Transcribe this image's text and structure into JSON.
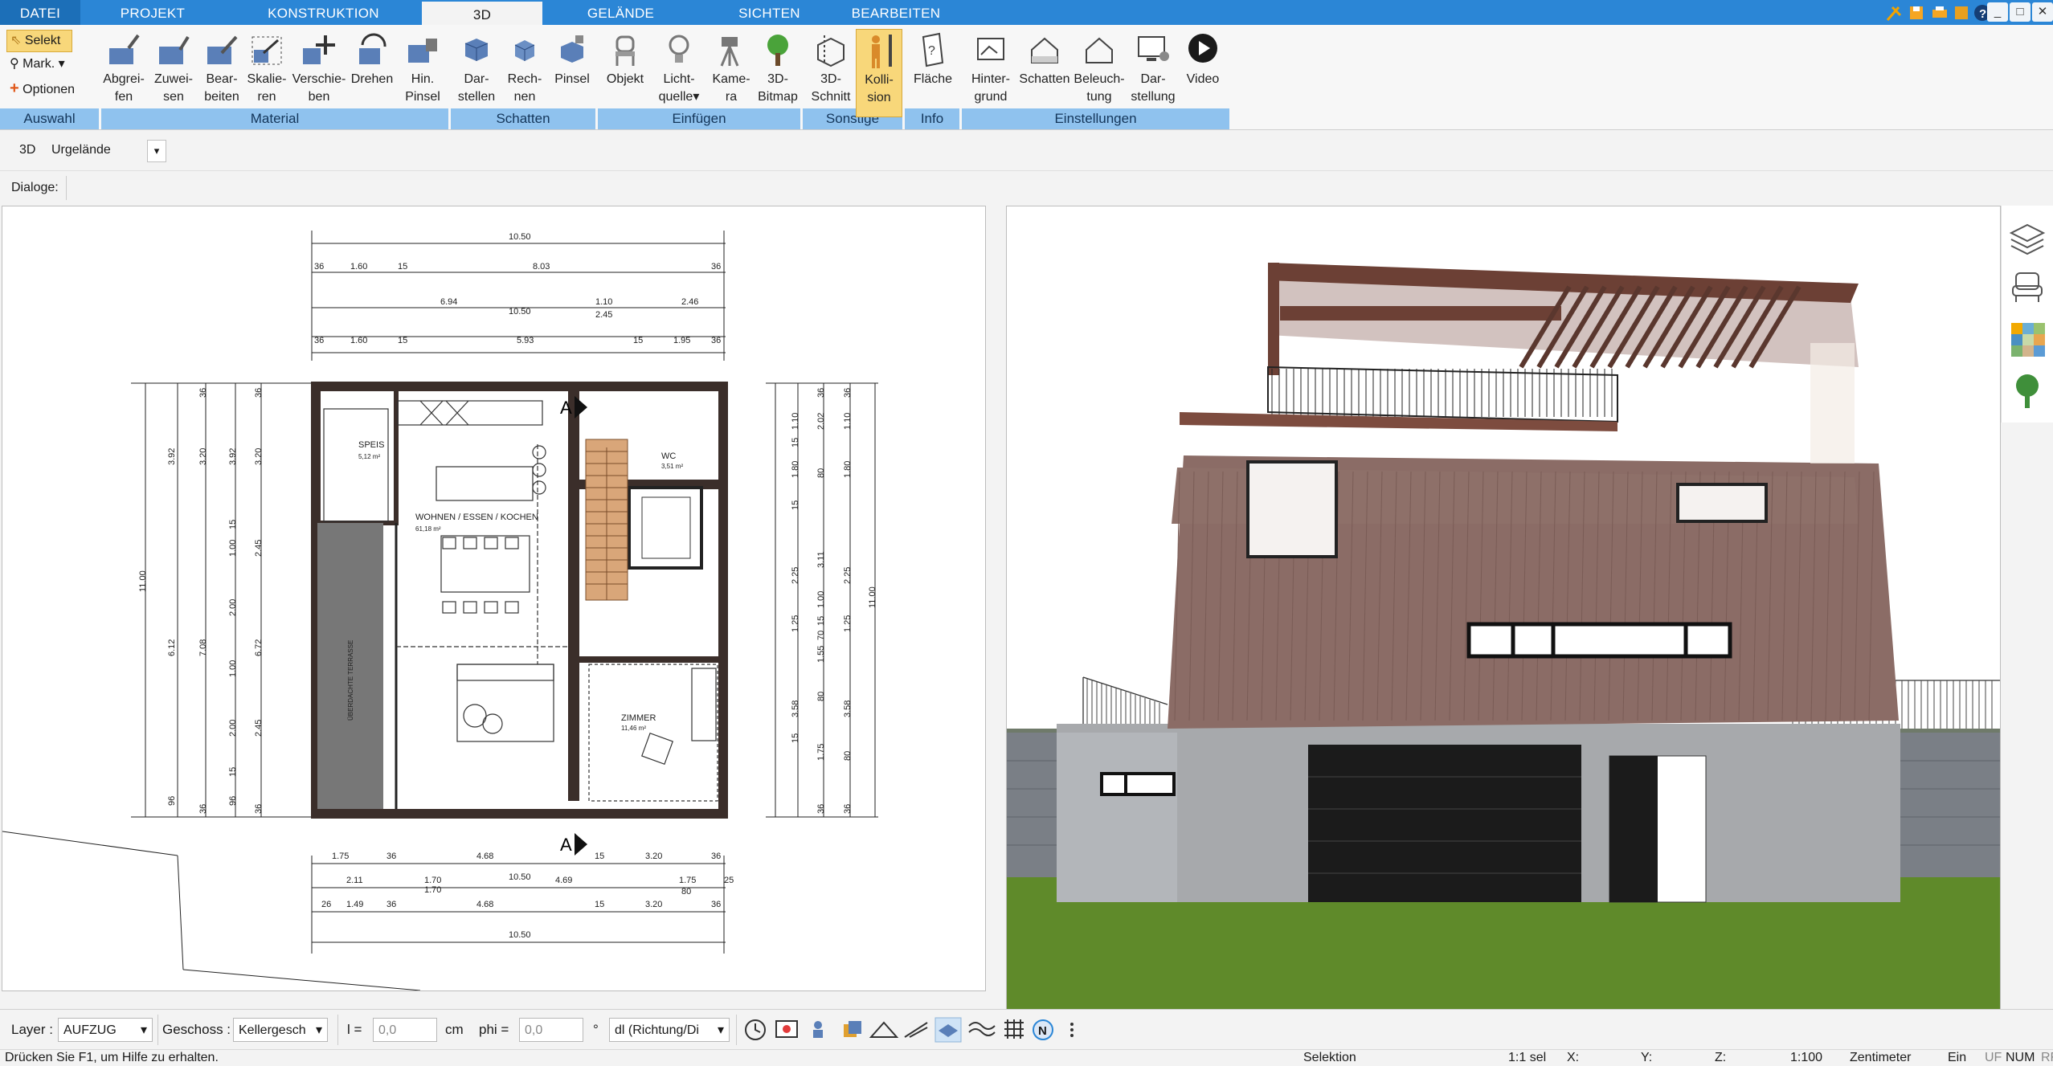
{
  "tabs": [
    "DATEI",
    "PROJEKT",
    "KONSTRUKTION",
    "3D",
    "GELÄNDE",
    "SICHTEN",
    "BEARBEITEN"
  ],
  "window_buttons": [
    "_",
    "□",
    "✕"
  ],
  "auswahl": {
    "selekt": "Selekt",
    "mark": "Mark.",
    "optionen": "Optionen",
    "group": "Auswahl"
  },
  "material": {
    "group": "Material",
    "items": [
      [
        "Abgrei-",
        "fen"
      ],
      [
        "Zuwei-",
        "sen"
      ],
      [
        "Bear-",
        "beiten"
      ],
      [
        "Skalie-",
        "ren"
      ],
      [
        "Verschie-",
        "ben"
      ],
      [
        "Drehen",
        ""
      ],
      [
        "Hin.",
        "Pinsel"
      ]
    ]
  },
  "schatten": {
    "group": "Schatten",
    "items": [
      [
        "Dar-",
        "stellen"
      ],
      [
        "Rech-",
        "nen"
      ],
      [
        "Pinsel",
        ""
      ]
    ]
  },
  "einfuegen": {
    "group": "Einfügen",
    "items": [
      [
        "Objekt",
        ""
      ],
      [
        "Licht-",
        "quelle"
      ],
      [
        "Kame-",
        "ra"
      ],
      [
        "3D-",
        "Bitmap"
      ]
    ]
  },
  "sonstige": {
    "group": "Sonstige",
    "items": [
      [
        "3D-",
        "Schnitt"
      ],
      [
        "Kolli-",
        "sion"
      ]
    ]
  },
  "info": {
    "group": "Info",
    "items": [
      [
        "Fläche",
        ""
      ]
    ]
  },
  "einstellungen": {
    "group": "Einstellungen",
    "items": [
      [
        "Hinter-",
        "grund"
      ],
      [
        "Schatten",
        ""
      ],
      [
        "Beleuch-",
        "tung"
      ],
      [
        "Dar-",
        "stellung"
      ],
      [
        "Video",
        ""
      ]
    ]
  },
  "toolbar3d": {
    "label": "3D",
    "select": "Urgelände"
  },
  "dialoge_label": "Dialoge:",
  "plan": {
    "rooms": [
      {
        "name": "SPEIS",
        "area": "5,12 m²"
      },
      {
        "name": "WOHNEN / ESSEN / KOCHEN",
        "area": "61,18 m²"
      },
      {
        "name": "WC",
        "area": "3,51 m²"
      },
      {
        "name": "ZIMMER",
        "area": "11,46 m²"
      },
      {
        "name": "ÜBERDACHTE TERRASSE",
        "area": ""
      }
    ],
    "section_marker": "A",
    "dims_top": [
      {
        "t": "10.50"
      },
      {
        "t": "36"
      },
      {
        "t": "1.60"
      },
      {
        "t": "15"
      },
      {
        "t": "8.03"
      },
      {
        "t": "36"
      },
      {
        "t": "6.94"
      },
      {
        "t": "1.10"
      },
      {
        "t": "2.46"
      },
      {
        "t": "10.50"
      },
      {
        "t": "2.45"
      },
      {
        "t": "36"
      },
      {
        "t": "1.60"
      },
      {
        "t": "15"
      },
      {
        "t": "5.93"
      },
      {
        "t": "15"
      },
      {
        "t": "1.95"
      },
      {
        "t": "36"
      }
    ],
    "dims_bottom": [
      {
        "t": "1.75"
      },
      {
        "t": "36"
      },
      {
        "t": "4.68"
      },
      {
        "t": "15"
      },
      {
        "t": "3.20"
      },
      {
        "t": "36"
      },
      {
        "t": "2.11"
      },
      {
        "t": "1.70"
      },
      {
        "t": "10.50"
      },
      {
        "t": "4.69"
      },
      {
        "t": "1.75"
      },
      {
        "t": "1.70"
      },
      {
        "t": "80"
      },
      {
        "t": "25"
      },
      {
        "t": "26"
      },
      {
        "t": "1.49"
      },
      {
        "t": "36"
      },
      {
        "t": "4.68"
      },
      {
        "t": "15"
      },
      {
        "t": "3.20"
      },
      {
        "t": "36"
      },
      {
        "t": "10.50"
      }
    ],
    "dims_left": [
      {
        "t": "36"
      },
      {
        "t": "36"
      },
      {
        "t": "3.92"
      },
      {
        "t": "3.20"
      },
      {
        "t": "3.92"
      },
      {
        "t": "3.20"
      },
      {
        "t": "15"
      },
      {
        "t": "1.00"
      },
      {
        "t": "2.45"
      },
      {
        "t": "11.00"
      },
      {
        "t": "6.12"
      },
      {
        "t": "7.08"
      },
      {
        "t": "2.00"
      },
      {
        "t": "1.00"
      },
      {
        "t": "6.72"
      },
      {
        "t": "2.00"
      },
      {
        "t": "2.45"
      },
      {
        "t": "15"
      },
      {
        "t": "96"
      },
      {
        "t": "96"
      },
      {
        "t": "36"
      },
      {
        "t": "36"
      }
    ],
    "dims_right": [
      {
        "t": "36"
      },
      {
        "t": "36"
      },
      {
        "t": "1.10"
      },
      {
        "t": "2.02"
      },
      {
        "t": "1.10"
      },
      {
        "t": "15"
      },
      {
        "t": "1.80"
      },
      {
        "t": "80"
      },
      {
        "t": "1.80"
      },
      {
        "t": "15"
      },
      {
        "t": "3.11"
      },
      {
        "t": "2.25"
      },
      {
        "t": "2.25"
      },
      {
        "t": "1.00"
      },
      {
        "t": "11.00"
      },
      {
        "t": "1.25"
      },
      {
        "t": "15"
      },
      {
        "t": "70"
      },
      {
        "t": "1.55"
      },
      {
        "t": "1.25"
      },
      {
        "t": "80"
      },
      {
        "t": "3.58"
      },
      {
        "t": "3.58"
      },
      {
        "t": "15"
      },
      {
        "t": "1.75"
      },
      {
        "t": "80"
      },
      {
        "t": "36"
      },
      {
        "t": "36"
      }
    ]
  },
  "bottom": {
    "layer_label": "Layer :",
    "layer_value": "AUFZUG",
    "geschoss_label": "Geschoss :",
    "geschoss_value": "Kellergesch",
    "l_label": "l =",
    "l_value": "0,0",
    "l_unit": "cm",
    "phi_label": "phi =",
    "phi_value": "0,0",
    "phi_unit": "°",
    "dl_value": "dl (Richtung/Di"
  },
  "status": {
    "help": "Drücken Sie F1, um Hilfe zu erhalten.",
    "mode": "Selektion",
    "sel": "1:1 sel",
    "x": "X:",
    "y": "Y:",
    "z": "Z:",
    "scale": "1:100",
    "unit": "Zentimeter",
    "ein": "Ein",
    "uf": "UF",
    "num": "NUM",
    "rf": "RF"
  },
  "colors": {
    "tab_blue": "#2b86d6",
    "group_blue": "#8fc2ee",
    "selected": "#f8d77a",
    "wall": "#3b2e2a",
    "facade": "#8b6c66",
    "grass": "#5f8a2a"
  }
}
